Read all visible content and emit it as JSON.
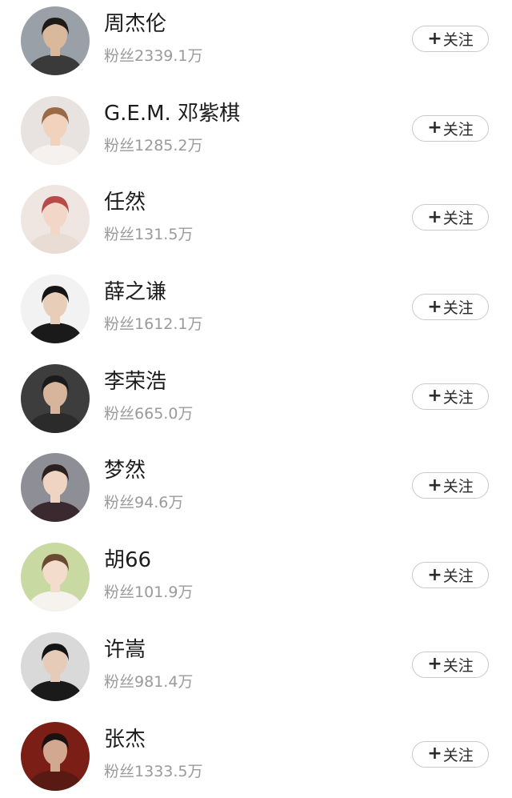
{
  "fans_prefix": "粉丝",
  "follow_label": "关注",
  "plus_glyph": "+",
  "users": [
    {
      "name": "周杰伦",
      "fans": "2339.1万",
      "skin": "#d9b89c",
      "hair": "#1d1a18",
      "cloth": "#3a3a3a",
      "bg": "#9aa0a8"
    },
    {
      "name": "G.E.M. 邓紫棋",
      "fans": "1285.2万",
      "skin": "#f0d2bd",
      "hair": "#9a6a45",
      "cloth": "#f4f1ee",
      "bg": "#e8e3e0"
    },
    {
      "name": "任然",
      "fans": "131.5万",
      "skin": "#f2d6c8",
      "hair": "#b84a4a",
      "cloth": "#e9dcd5",
      "bg": "#efe6e2"
    },
    {
      "name": "薛之谦",
      "fans": "1612.1万",
      "skin": "#e8cdb9",
      "hair": "#151515",
      "cloth": "#1a1a1a",
      "bg": "#f2f2f2"
    },
    {
      "name": "李荣浩",
      "fans": "665.0万",
      "skin": "#d7b59c",
      "hair": "#1b1b1b",
      "cloth": "#2b2b2b",
      "bg": "#3d3d3d"
    },
    {
      "name": "梦然",
      "fans": "94.6万",
      "skin": "#efd3c3",
      "hair": "#2a2020",
      "cloth": "#3a2a30",
      "bg": "#8e8e96"
    },
    {
      "name": "胡66",
      "fans": "101.9万",
      "skin": "#f3dccb",
      "hair": "#6b4a33",
      "cloth": "#f6f3ee",
      "bg": "#c9d9a2"
    },
    {
      "name": "许嵩",
      "fans": "981.4万",
      "skin": "#e6ccb8",
      "hair": "#141414",
      "cloth": "#1a1a1a",
      "bg": "#d9d9d9"
    },
    {
      "name": "张杰",
      "fans": "1333.5万",
      "skin": "#d3a890",
      "hair": "#1a1210",
      "cloth": "#5a1a14",
      "bg": "#7a1e16"
    }
  ]
}
